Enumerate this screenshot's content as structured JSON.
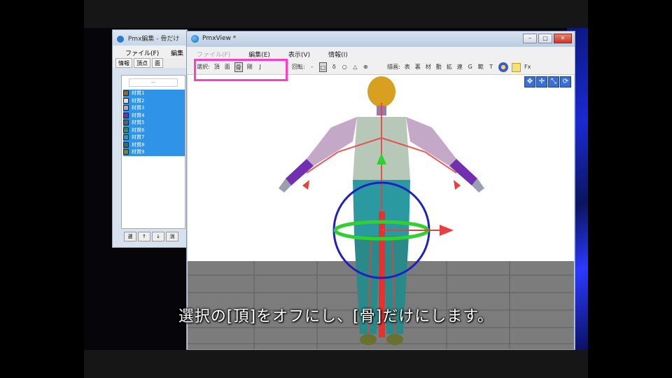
{
  "editor_window": {
    "title": "Pmx編集 - 骨だけ",
    "menu": [
      "ファイル(F)",
      "編集"
    ],
    "tabs": [
      "情報",
      "頂点",
      "面"
    ],
    "list_dropdown": "--",
    "list_items": [
      "材質1",
      "材質2",
      "材質3",
      "材質4",
      "材質5",
      "材質6",
      "材質7",
      "材質8",
      "材質9"
    ],
    "list_colors": [
      "#8a6a30",
      "#e0e0e0",
      "#b8a8c8",
      "#6a3aa0",
      "#4a6a6a",
      "#2a8a8a",
      "#3a9a9a",
      "#307070",
      "#6a8a40"
    ],
    "buttons": [
      "選",
      "↑",
      "↓",
      "消"
    ]
  },
  "view_window": {
    "title": "PmxView",
    "title_marker": "*",
    "controls": {
      "minimize": "–",
      "maximize": "□",
      "close": "✕"
    },
    "menu": [
      {
        "label": "ファイル(F)",
        "dim": true
      },
      {
        "label": "編集(E)",
        "dim": false
      },
      {
        "label": "表示(V)",
        "dim": false
      },
      {
        "label": "情報(I)",
        "dim": false
      }
    ],
    "toolbar": {
      "select_label": "選択:",
      "select_items": [
        {
          "label": "頂",
          "pressed": false
        },
        {
          "label": "面",
          "pressed": false
        },
        {
          "label": "骨",
          "pressed": true
        },
        {
          "label": "剛",
          "pressed": false
        },
        {
          "label": "J",
          "pressed": false
        }
      ],
      "pivot_label": "回転:",
      "pivot_items": [
        "-",
        "□",
        "δ",
        "○",
        "△",
        "⊕"
      ],
      "display_label": "描画:",
      "display_items": [
        "表",
        "裏",
        "材",
        "動",
        "拡",
        "連",
        "G",
        "範",
        "T"
      ],
      "fx_label": "Fx"
    },
    "nav_icons": [
      "move-icon",
      "pan-icon",
      "zoom-icon",
      "rotate-icon"
    ],
    "nav_glyphs": [
      "✥",
      "✛",
      "⤡",
      "⟳"
    ]
  },
  "subtitle": "選択の[頂]をオフにし、[骨]だけにします。",
  "colors": {
    "highlight": "#ff3ec8",
    "list_selection": "#2f93e8",
    "viewport_bg": "#ffffff",
    "floor": "#7c7c7c",
    "gizmo_ring": "#2020c0",
    "gizmo_ring_green": "#30d030",
    "bone": "#e84040"
  }
}
